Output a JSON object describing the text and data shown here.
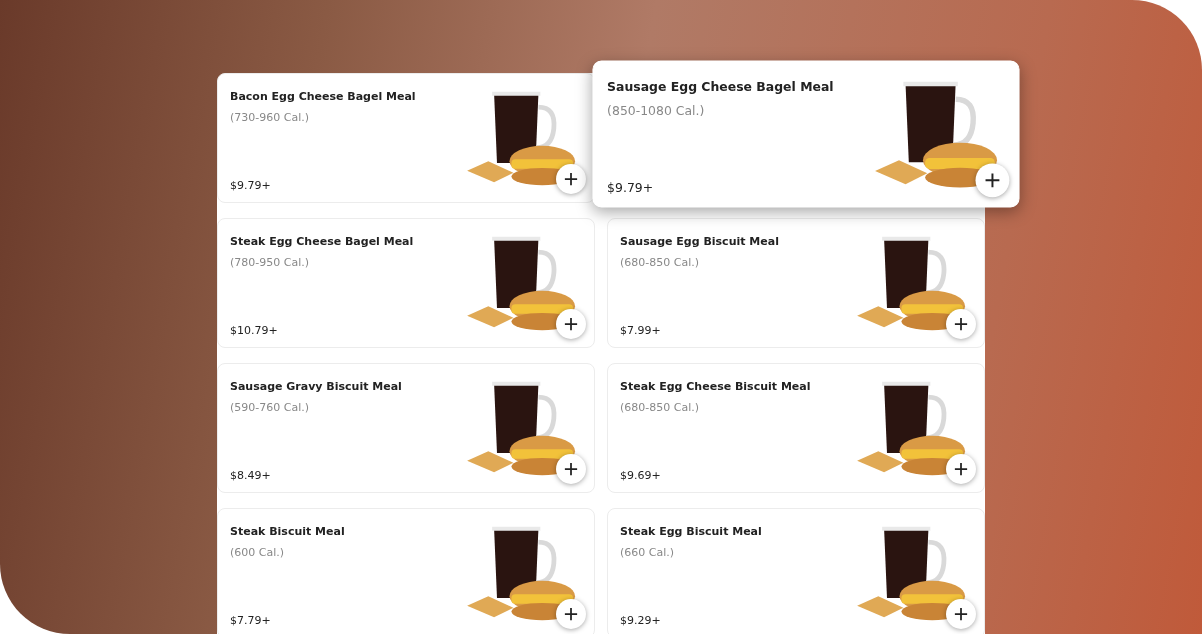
{
  "menu_items": [
    {
      "name": "Bacon Egg Cheese Bagel Meal",
      "calories": "(730-960 Cal.)",
      "price": "$9.79+",
      "highlighted": false
    },
    {
      "name": "Sausage Egg Cheese Bagel Meal",
      "calories": "(850-1080 Cal.)",
      "price": "$9.79+",
      "highlighted": true
    },
    {
      "name": "Steak Egg Cheese Bagel Meal",
      "calories": "(780-950 Cal.)",
      "price": "$10.79+",
      "highlighted": false
    },
    {
      "name": "Sausage Egg Biscuit Meal",
      "calories": "(680-850 Cal.)",
      "price": "$7.99+",
      "highlighted": false
    },
    {
      "name": "Sausage Gravy Biscuit Meal",
      "calories": "(590-760 Cal.)",
      "price": "$8.49+",
      "highlighted": false
    },
    {
      "name": "Steak Egg Cheese Biscuit Meal",
      "calories": "(680-850 Cal.)",
      "price": "$9.69+",
      "highlighted": false
    },
    {
      "name": "Steak Biscuit Meal",
      "calories": "(600 Cal.)",
      "price": "$7.79+",
      "highlighted": false
    },
    {
      "name": "Steak Egg Biscuit Meal",
      "calories": "(660 Cal.)",
      "price": "$9.29+",
      "highlighted": false
    }
  ]
}
